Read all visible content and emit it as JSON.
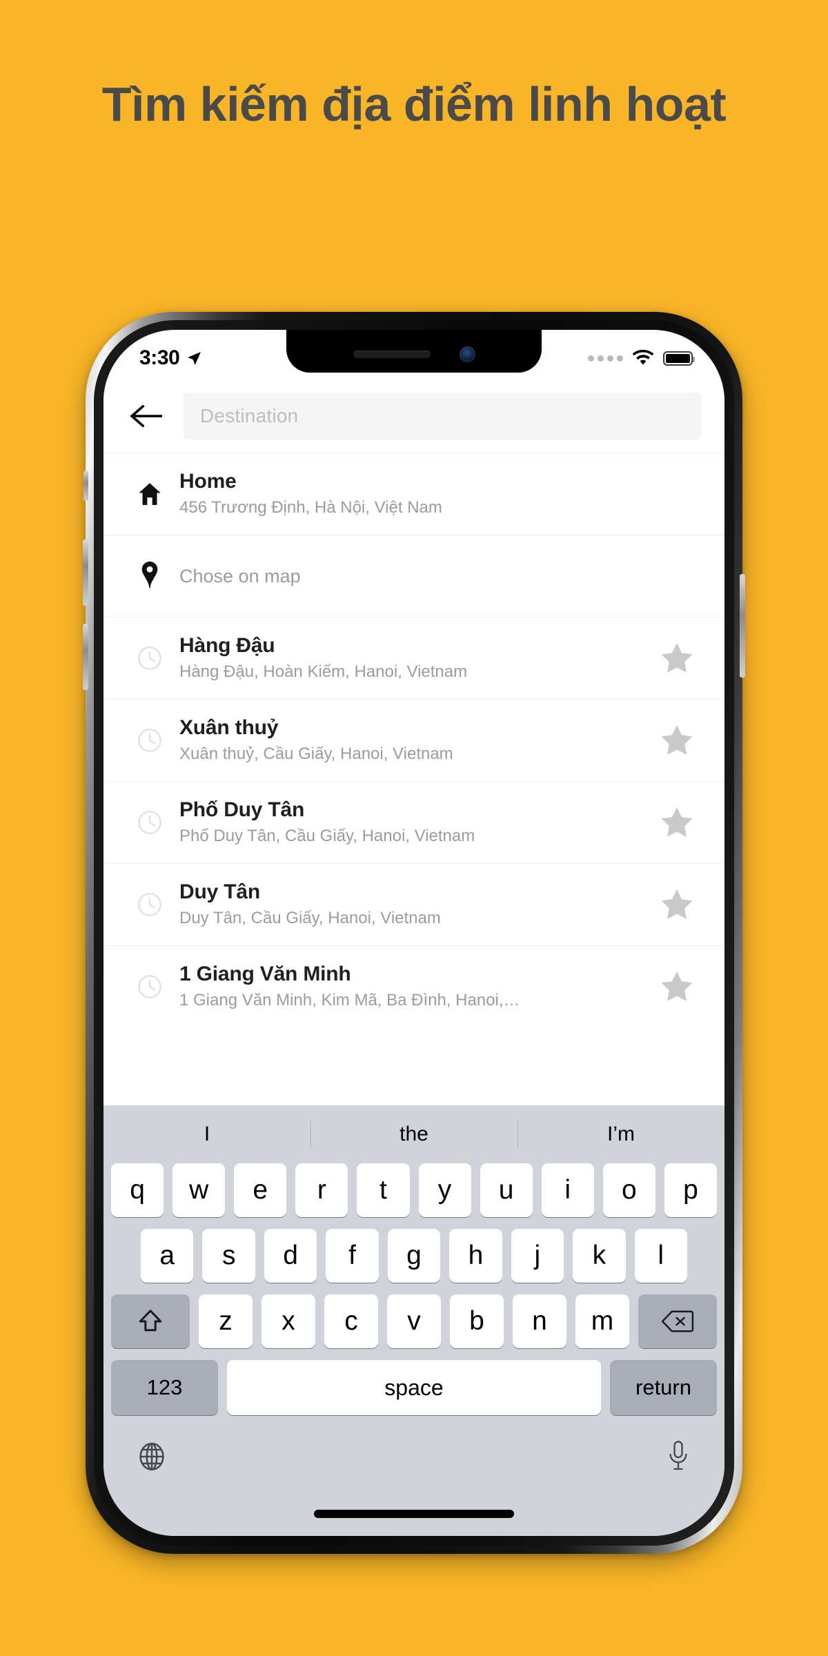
{
  "page": {
    "headline": "Tìm kiếm địa điểm linh hoạt",
    "background_color": "#f8b527",
    "headline_color": "#4a4a4a"
  },
  "status_bar": {
    "time": "3:30",
    "location_icon": "location-arrow-icon",
    "signal_icon": "signal-dots-icon",
    "wifi_icon": "wifi-icon",
    "battery_icon": "battery-full-icon"
  },
  "search_header": {
    "back_icon": "arrow-left-icon",
    "placeholder": "Destination",
    "value": ""
  },
  "results": [
    {
      "icon": "home-icon",
      "title": "Home",
      "subtitle": "456 Trương Định, Hà Nội, Việt Nam",
      "starred": false,
      "has_star": false
    },
    {
      "icon": "map-pin-icon",
      "title": "Chose on map",
      "subtitle": "",
      "single_line": true,
      "has_star": false
    },
    {
      "icon": "clock-icon",
      "title": "Hàng Đậu",
      "subtitle": "Hàng Đậu, Hoàn Kiếm, Hanoi, Vietnam",
      "has_star": true
    },
    {
      "icon": "clock-icon",
      "title": "Xuân thuỷ",
      "subtitle": "Xuân thuỷ, Cầu Giấy, Hanoi, Vietnam",
      "has_star": true
    },
    {
      "icon": "clock-icon",
      "title": "Phố Duy Tân",
      "subtitle": "Phố Duy Tân, Cầu Giấy, Hanoi, Vietnam",
      "has_star": true
    },
    {
      "icon": "clock-icon",
      "title": "Duy Tân",
      "subtitle": "Duy Tân, Cầu Giấy, Hanoi, Vietnam",
      "has_star": true
    },
    {
      "icon": "clock-icon",
      "title": "1 Giang Văn Minh",
      "subtitle": "1 Giang Văn Minh, Kim Mã, Ba Đình, Hanoi,…",
      "has_star": true
    }
  ],
  "keyboard": {
    "predictions": [
      "I",
      "the",
      "I’m"
    ],
    "row1": [
      "q",
      "w",
      "e",
      "r",
      "t",
      "y",
      "u",
      "i",
      "o",
      "p"
    ],
    "row2": [
      "a",
      "s",
      "d",
      "f",
      "g",
      "h",
      "j",
      "k",
      "l"
    ],
    "row3": [
      "z",
      "x",
      "c",
      "v",
      "b",
      "n",
      "m"
    ],
    "shift_icon": "shift-up-icon",
    "backspace_icon": "backspace-icon",
    "numeric_label": "123",
    "space_label": "space",
    "return_label": "return",
    "globe_icon": "globe-icon",
    "mic_icon": "microphone-icon"
  }
}
